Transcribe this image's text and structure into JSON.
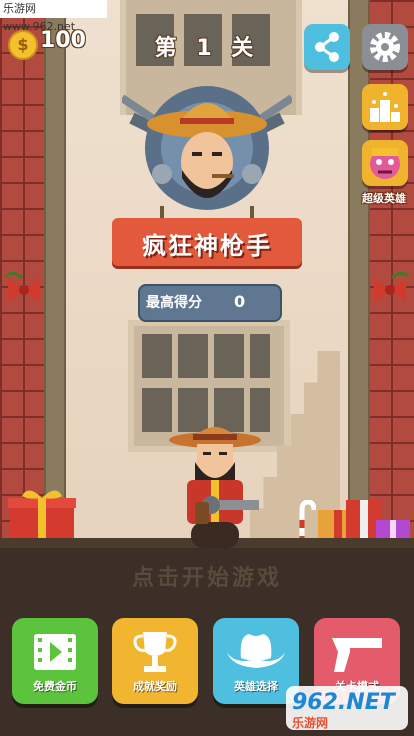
{
  "watermark_top": "乐游网 www.962.net",
  "watermark_bottom": {
    "big": "962.NET",
    "small": "乐游网"
  },
  "topbar": {
    "coin_symbol": "$",
    "coins": "100",
    "level": "第 1 关"
  },
  "side": {
    "hero_label": "超级英雄"
  },
  "title": "疯狂神枪手",
  "score": {
    "label": "最高得分",
    "value": "0"
  },
  "prompt": "点击开始游戏",
  "menu": [
    {
      "label": "免费金币",
      "icon": "video-icon"
    },
    {
      "label": "成就奖励",
      "icon": "trophy-icon"
    },
    {
      "label": "英雄选择",
      "icon": "hat-icon"
    },
    {
      "label": "关卡模式",
      "icon": "gun-icon"
    }
  ],
  "colors": {
    "accent_orange": "#e25a3b",
    "coin_yellow": "#f3c12e",
    "green": "#5cc33c",
    "blue": "#4fbfe0",
    "pink": "#e45b6c",
    "gold": "#f2b52f"
  }
}
